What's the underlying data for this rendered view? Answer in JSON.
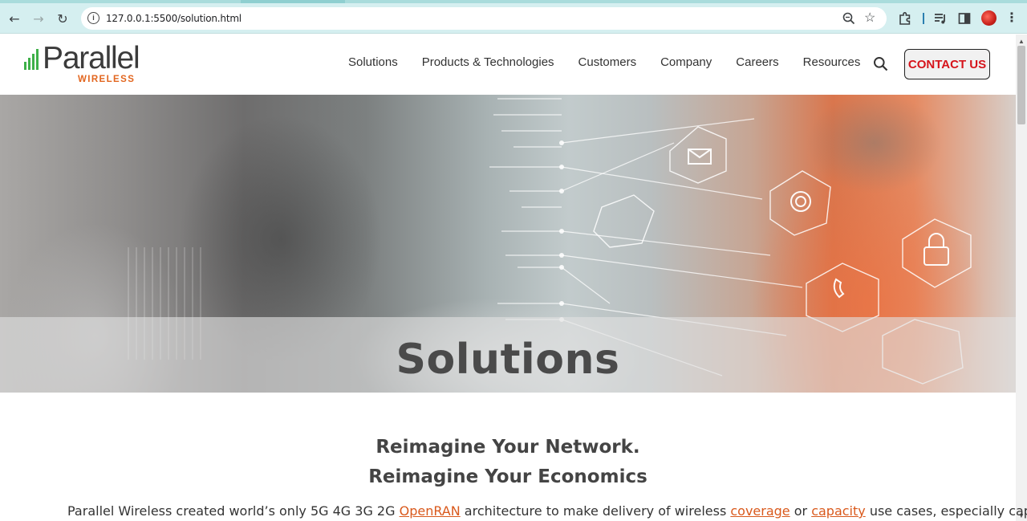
{
  "browser": {
    "url": "127.0.0.1:5500/solution.html",
    "back_label": "←",
    "forward_label": "→",
    "reload_label": "↻",
    "star_label": "☆",
    "menu_label": "⋮",
    "icons": {
      "site_info": "info-icon",
      "zoom": "zoom-icon",
      "bookmark": "star-icon",
      "extensions": "puzzle-icon",
      "media": "media-queue-icon",
      "side_panel": "side-panel-icon",
      "profile": "profile-avatar"
    }
  },
  "header": {
    "logo": {
      "name": "Parallel",
      "sub": "WIRELESS"
    },
    "nav": [
      {
        "label": "Solutions"
      },
      {
        "label": "Products & Technologies"
      },
      {
        "label": "Customers"
      },
      {
        "label": "Company"
      },
      {
        "label": "Careers"
      },
      {
        "label": "Resources"
      }
    ],
    "contact_label": "CONTACT US"
  },
  "hero": {
    "title": "Solutions"
  },
  "intro": {
    "heading_line1": "Reimagine Your Network.",
    "heading_line2": "Reimagine Your Economics",
    "text_before": "Parallel Wireless created world’s only 5G 4G 3G 2G ",
    "link_openran": "OpenRAN",
    "text_mid1": " architecture to make delivery of wireless ",
    "link_coverage": "coverage",
    "text_mid2": " or ",
    "link_capacity": "capacity",
    "text_after": " use cases, especially capital"
  },
  "colors": {
    "brand_green": "#3eb049",
    "brand_orange": "#e2661f",
    "contact_red": "#d6141b",
    "link_orange": "#d9591c",
    "chrome_bg": "#d5eff0"
  }
}
